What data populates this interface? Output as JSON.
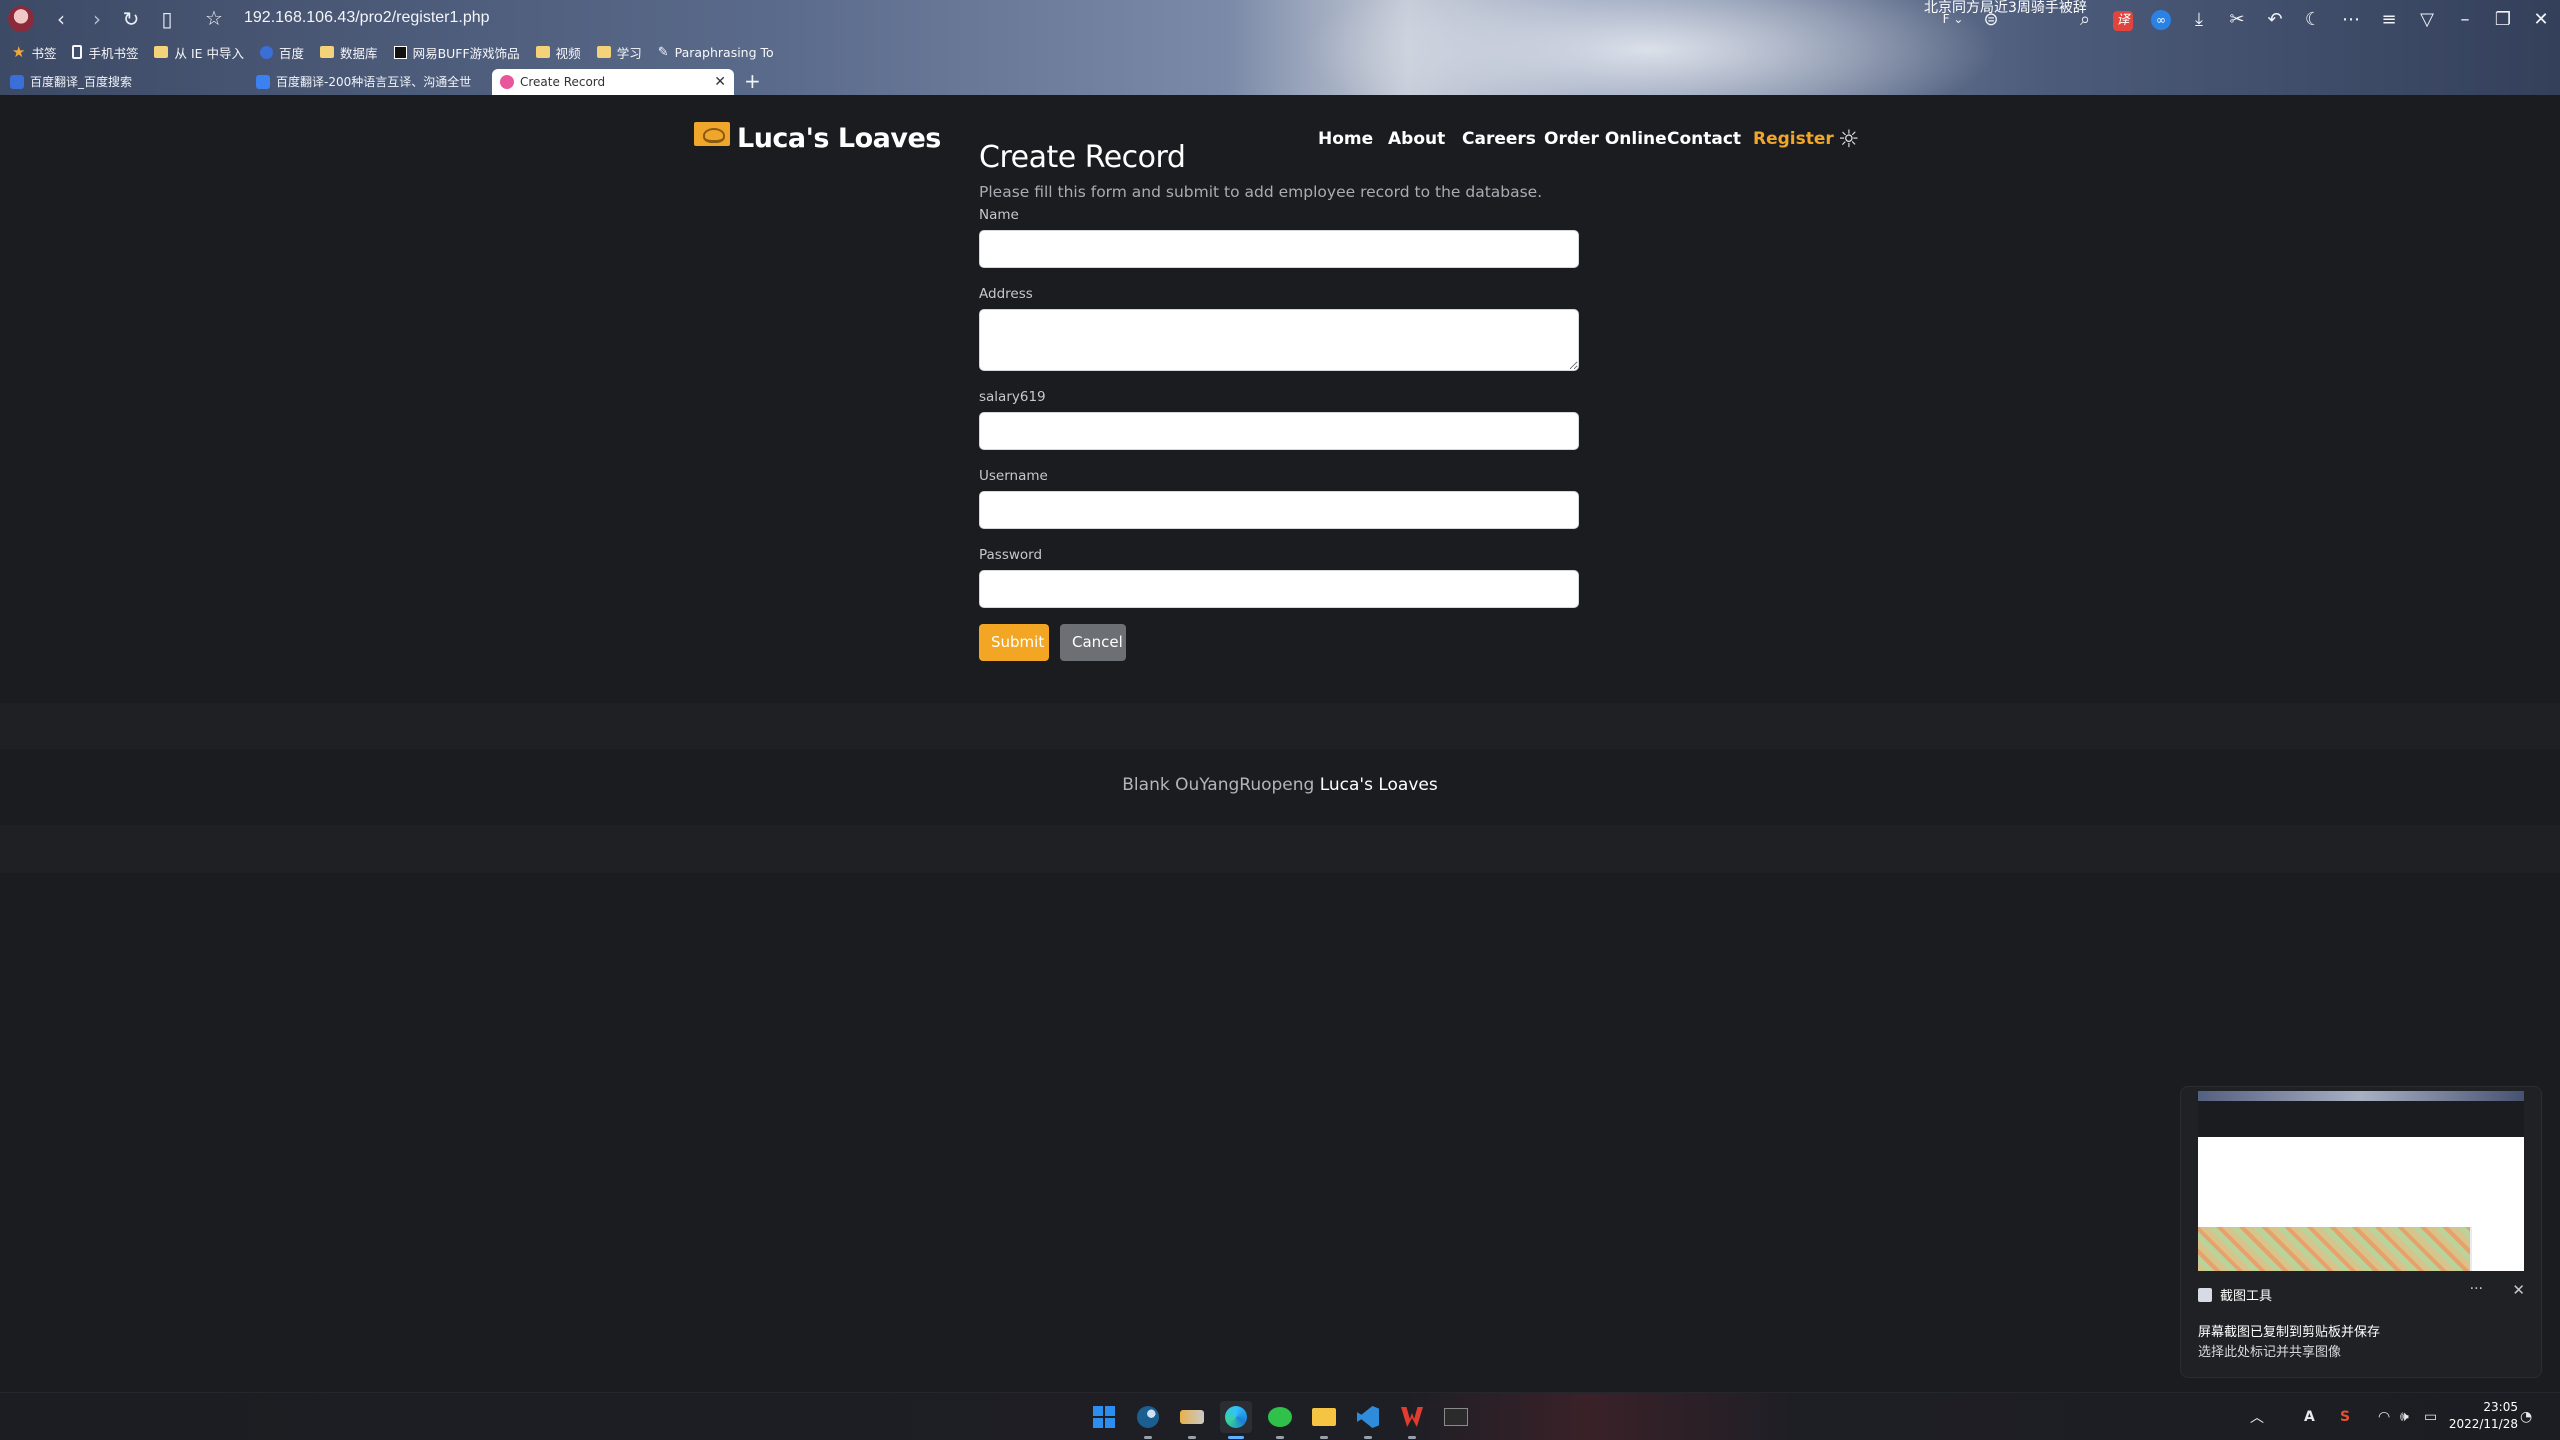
{
  "browser": {
    "url": "192.168.106.43/pro2/register1.php",
    "top_clip_text": "北京同方局近3周骑手被辞",
    "bookmarks": [
      {
        "label": "书签",
        "icon": "star-icon"
      },
      {
        "label": "手机书签",
        "icon": "phone-icon"
      },
      {
        "label": "从 IE 中导入",
        "icon": "folder-icon"
      },
      {
        "label": "百度",
        "icon": "baidu-icon"
      },
      {
        "label": "数据库",
        "icon": "folder-icon"
      },
      {
        "label": "网易BUFF游戏饰品",
        "icon": "buff-icon"
      },
      {
        "label": "视频",
        "icon": "folder-icon"
      },
      {
        "label": "学习",
        "icon": "folder-icon"
      },
      {
        "label": "Paraphrasing To",
        "icon": "pen-icon"
      }
    ],
    "tabs": [
      {
        "label": "百度翻译_百度搜索",
        "active": false
      },
      {
        "label": "百度翻译-200种语言互译、沟通全世",
        "active": false
      },
      {
        "label": "Create Record",
        "active": true
      }
    ]
  },
  "site": {
    "brand": "Luca's Loaves",
    "nav": [
      {
        "label": "Home",
        "active": false
      },
      {
        "label": "About",
        "active": false
      },
      {
        "label": "Careers",
        "active": false
      },
      {
        "label": "Order Online",
        "active": false
      },
      {
        "label": "Contact",
        "active": false
      },
      {
        "label": "Register",
        "active": true
      }
    ],
    "accent_color": "#f0a62a"
  },
  "form": {
    "title": "Create Record",
    "subtitle": "Please fill this form and submit to add employee record to the database.",
    "fields": {
      "name": {
        "label": "Name",
        "value": ""
      },
      "address": {
        "label": "Address",
        "value": ""
      },
      "salary": {
        "label": "salary619",
        "value": ""
      },
      "username": {
        "label": "Username",
        "value": ""
      },
      "password": {
        "label": "Password",
        "value": ""
      }
    },
    "submit_label": "Submit",
    "cancel_label": "Cancel"
  },
  "footer": {
    "credit_prefix": "Blank OuYangRuopeng",
    "credit_brand": "Luca's Loaves"
  },
  "toast": {
    "app_name": "截图工具",
    "title": "屏幕截图已复制到剪贴板并保存",
    "body": "选择此处标记并共享图像",
    "more": "···",
    "close": "✕"
  },
  "taskbar": {
    "time": "23:05",
    "date": "2022/11/28",
    "ime": "A"
  }
}
